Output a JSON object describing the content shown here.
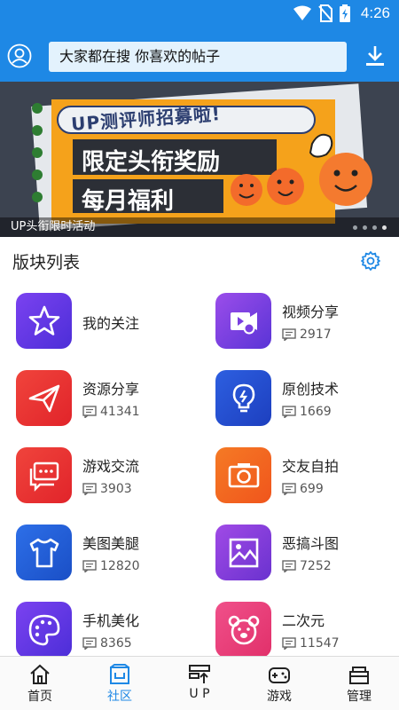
{
  "status_bar": {
    "time": "4:26"
  },
  "header": {
    "search_text": "大家都在搜  你喜欢的帖子"
  },
  "banner": {
    "artwork_lines": [
      "UP测评师招募啦!",
      "限定头衔奖励",
      "每月福利"
    ],
    "caption": "UP头衔限时活动",
    "page_count": 4,
    "active_page": 4
  },
  "section": {
    "title": "版块列表"
  },
  "boards": [
    {
      "name": "我的关注",
      "count": "",
      "icon": "star-icon",
      "color_from": "#7b42f0",
      "color_to": "#4c2ed8"
    },
    {
      "name": "视频分享",
      "count": "2917",
      "icon": "video-icon",
      "color_from": "#9b4dea",
      "color_to": "#5a34d6"
    },
    {
      "name": "资源分享",
      "count": "41341",
      "icon": "paper-plane-icon",
      "color_from": "#f0443c",
      "color_to": "#e1242a"
    },
    {
      "name": "原创技术",
      "count": "1669",
      "icon": "lightbulb-icon",
      "color_from": "#2d5fe0",
      "color_to": "#1d3fbf"
    },
    {
      "name": "游戏交流",
      "count": "3903",
      "icon": "chat-bubble-icon",
      "color_from": "#f0443c",
      "color_to": "#e1242a"
    },
    {
      "name": "交友自拍",
      "count": "699",
      "icon": "camera-icon",
      "color_from": "#f57a25",
      "color_to": "#f0551c"
    },
    {
      "name": "美图美腿",
      "count": "12820",
      "icon": "tshirt-icon",
      "color_from": "#2d6fe8",
      "color_to": "#1a4fc6"
    },
    {
      "name": "恶搞斗图",
      "count": "7252",
      "icon": "image-icon",
      "color_from": "#a04ae6",
      "color_to": "#6a32cf"
    },
    {
      "name": "手机美化",
      "count": "8365",
      "icon": "palette-icon",
      "color_from": "#7b42f0",
      "color_to": "#4c2ed8"
    },
    {
      "name": "二次元",
      "count": "11547",
      "icon": "bear-icon",
      "color_from": "#f0508a",
      "color_to": "#e1306a"
    }
  ],
  "nav": [
    {
      "label": "首页",
      "icon": "home-icon",
      "active": false
    },
    {
      "label": "社区",
      "icon": "community-icon",
      "active": true
    },
    {
      "label": "U P",
      "icon": "up-icon",
      "active": false
    },
    {
      "label": "游戏",
      "icon": "gamepad-icon",
      "active": false
    },
    {
      "label": "管理",
      "icon": "manage-icon",
      "active": false
    }
  ],
  "colors": {
    "primary": "#1e88e5",
    "search_bg": "#e3f2fd",
    "banner_orange": "#f5a21b"
  }
}
